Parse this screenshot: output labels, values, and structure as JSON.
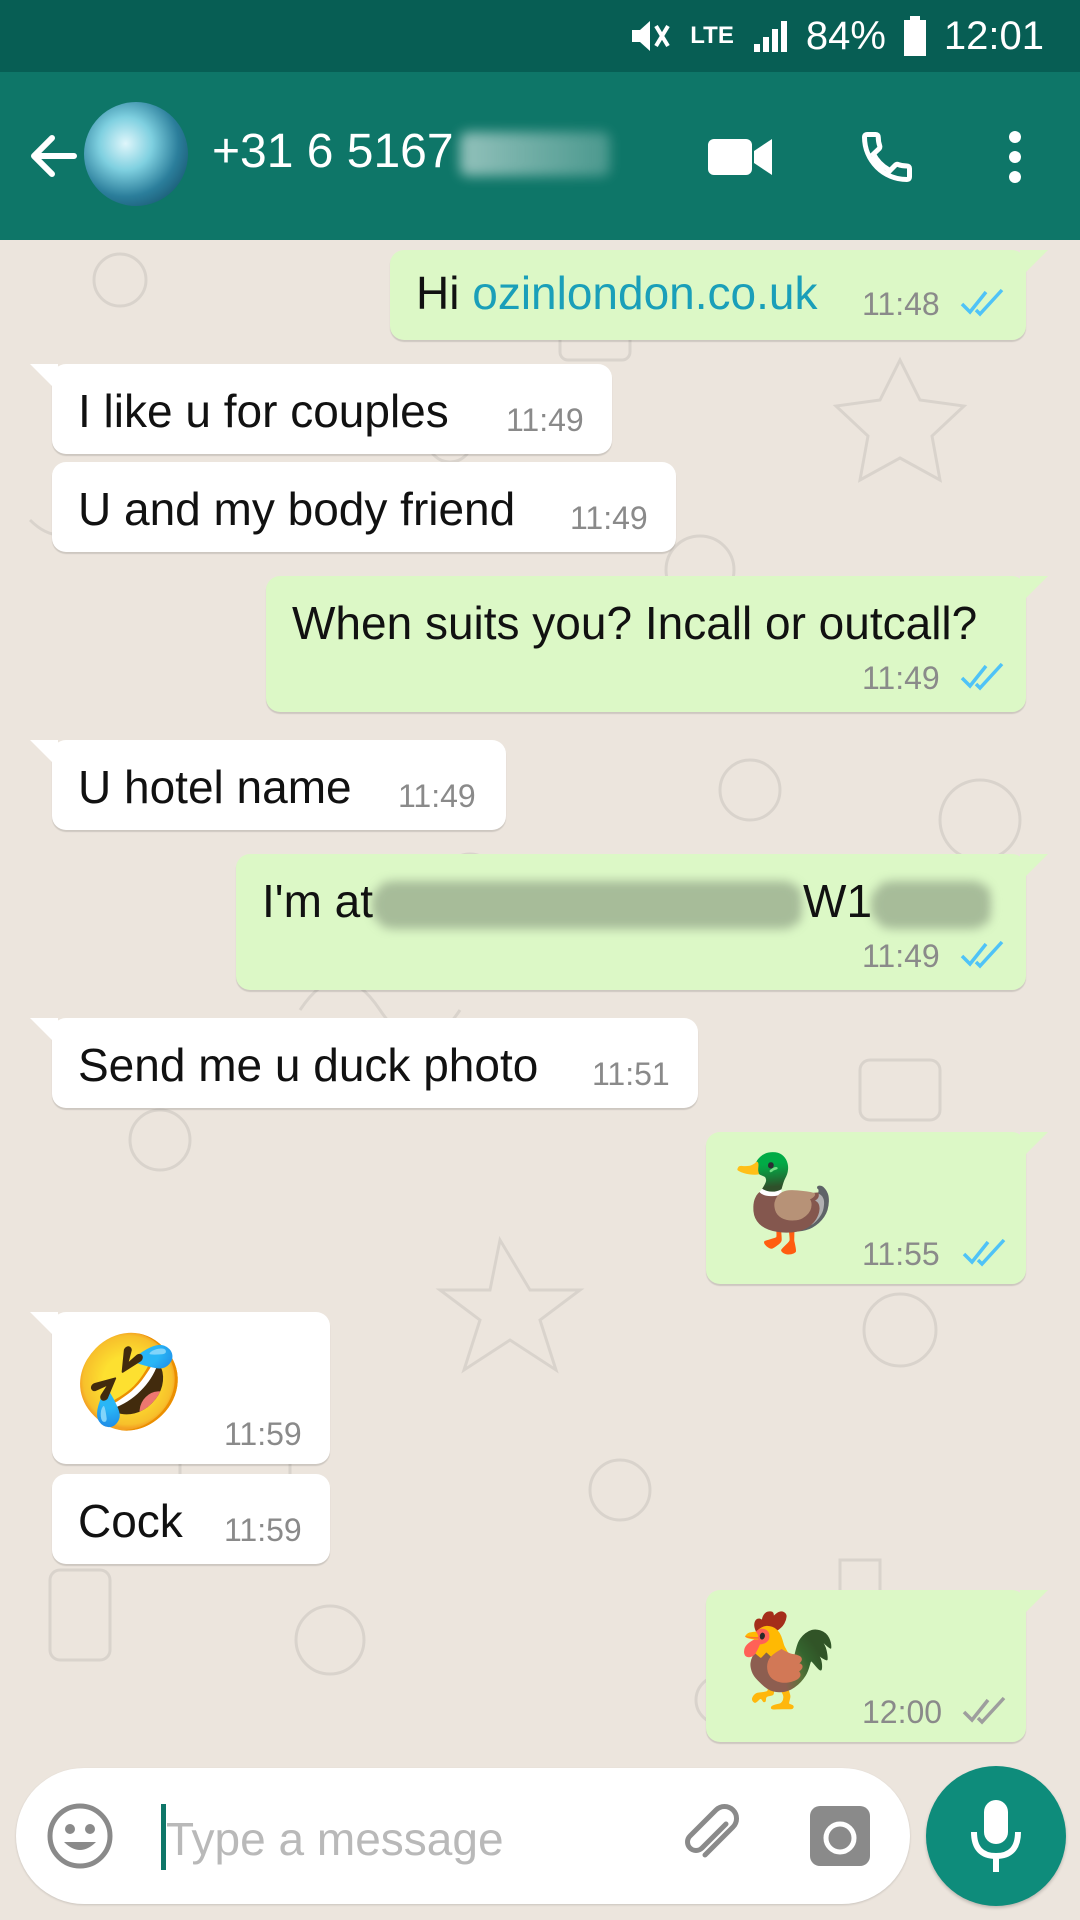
{
  "status_bar": {
    "network": "LTE",
    "battery": "84%",
    "time": "12:01"
  },
  "header": {
    "contact_name": "+31 6 5167"
  },
  "messages": [
    {
      "dir": "out",
      "prefix": "Hi ",
      "link": "ozinlondon.co.uk",
      "time": "11:48",
      "status": "read"
    },
    {
      "dir": "in",
      "text": "I like u for couples",
      "time": "11:49"
    },
    {
      "dir": "in",
      "text": "U and my body friend",
      "time": "11:49"
    },
    {
      "dir": "out",
      "text": "When suits you? Incall or outcall?",
      "time": "11:49",
      "status": "read"
    },
    {
      "dir": "in",
      "text": "U hotel name",
      "time": "11:49"
    },
    {
      "dir": "out",
      "text": "I'm at",
      "text2": "W1",
      "time": "11:49",
      "status": "read"
    },
    {
      "dir": "in",
      "text": "Send me u duck photo",
      "time": "11:51"
    },
    {
      "dir": "out",
      "emoji": "🦆",
      "time": "11:55",
      "status": "read"
    },
    {
      "dir": "in",
      "emoji": "🤣",
      "time": "11:59"
    },
    {
      "dir": "in",
      "text": "Cock",
      "time": "11:59"
    },
    {
      "dir": "out",
      "emoji": "🐓",
      "time": "12:00",
      "status": "delivered"
    }
  ],
  "composer": {
    "placeholder": "Type a message"
  },
  "colors": {
    "header": "#0E7668",
    "status_bar": "#075E54",
    "outgoing_bubble": "#DCF8C6",
    "incoming_bubble": "#FFFFFF",
    "read_ticks": "#4FC3F7",
    "delivered_ticks": "#9E9E9E",
    "wallpaper": "#ECE5DD"
  },
  "icons": [
    "mute-icon",
    "signal-icon",
    "battery-icon",
    "back-arrow-icon",
    "video-call-icon",
    "phone-icon",
    "more-vert-icon",
    "emoji-icon",
    "attach-icon",
    "camera-icon",
    "mic-icon"
  ]
}
